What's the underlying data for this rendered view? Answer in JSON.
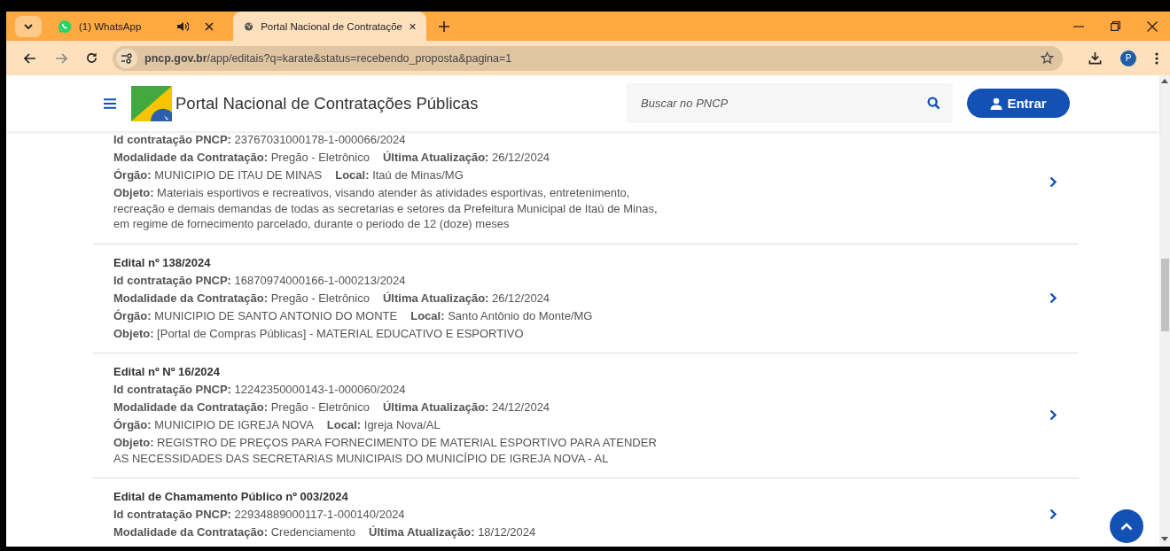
{
  "browser": {
    "tabs": [
      {
        "title": "(1) WhatsApp",
        "kind": "whatsapp",
        "audio": true,
        "selected": false
      },
      {
        "title": "Portal Nacional de Contrataçõe",
        "kind": "globe",
        "audio": false,
        "selected": true
      }
    ],
    "address": {
      "host": "pncp.gov.br",
      "path": "/app/editais?q=karate&status=recebendo_proposta&pagina=1"
    },
    "profile": "P"
  },
  "header": {
    "title": "Portal Nacional de Contratações Públicas",
    "search": {
      "placeholder": "Buscar no PNCP"
    },
    "login_button": "Entrar"
  },
  "results": [
    {
      "lines": [
        [
          "**Id contratação PNCP:** 23767031000178-1-000066/2024"
        ],
        [
          "**Modalidade da Contratação:** Pregão - Eletrônico",
          "**Última Atualização:** 26/12/2024"
        ],
        [
          "**Órgão:** MUNICIPIO DE ITAU DE MINAS",
          "**Local:** Itaú de Minas/MG"
        ]
      ],
      "objeto": "**Objeto:** Materiais esportivos e recreativos, visando atender às atividades esportivas, entretenimento, recreação e demais demandas de todas as secretarias e setores da Prefeitura Municipal de Itaú de Minas, em regime de fornecimento parcelado, durante o periodo de 12 (doze) meses"
    },
    {
      "title": "Edital nº 138/2024",
      "lines": [
        [
          "**Id contratação PNCP:** 16870974000166-1-000213/2024"
        ],
        [
          "**Modalidade da Contratação:** Pregão - Eletrônico",
          "**Última Atualização:** 26/12/2024"
        ],
        [
          "**Órgão:** MUNICIPIO DE SANTO ANTONIO DO MONTE",
          "**Local:** Santo Antônio do Monte/MG"
        ]
      ],
      "objeto": "**Objeto:** [Portal de Compras Públicas] - MATERIAL EDUCATIVO E ESPORTIVO"
    },
    {
      "title": "Edital nº Nº 16/2024",
      "lines": [
        [
          "**Id contratação PNCP:** 12242350000143-1-000060/2024"
        ],
        [
          "**Modalidade da Contratação:** Pregão - Eletrônico",
          "**Última Atualização:** 24/12/2024"
        ],
        [
          "**Órgão:** MUNICIPIO DE IGREJA NOVA",
          "**Local:** Igreja Nova/AL"
        ]
      ],
      "objeto": "**Objeto:** REGISTRO DE PREÇOS PARA FORNECIMENTO DE MATERIAL ESPORTIVO PARA ATENDER AS NECESSIDADES DAS SECRETARIAS MUNICIPAIS DO MUNICÍPIO DE IGREJA NOVA - AL"
    },
    {
      "title": "Edital de Chamamento Público nº 003/2024",
      "lines": [
        [
          "**Id contratação PNCP:** 22934889000117-1-000140/2024"
        ],
        [
          "**Modalidade da Contratação:** Credenciamento",
          "**Última Atualização:** 18/12/2024"
        ]
      ]
    }
  ]
}
